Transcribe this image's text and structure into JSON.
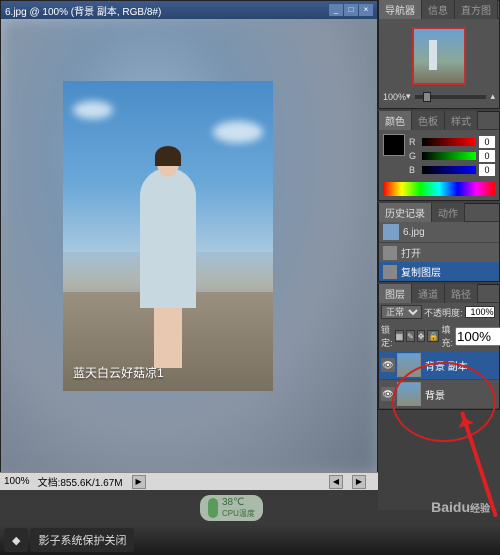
{
  "document": {
    "title": "6.jpg @ 100% (背景 副本, RGB/8#)",
    "caption": "蓝天白云好菇凉1"
  },
  "status": {
    "zoom": "100%",
    "docinfo": "文档:855.6K/1.67M"
  },
  "panels": {
    "navigator": {
      "tabs": [
        "导航器",
        "信息",
        "直方图"
      ],
      "zoom": "100%"
    },
    "color": {
      "tabs": [
        "颜色",
        "色板",
        "样式"
      ],
      "r": "0",
      "g": "0",
      "b": "0"
    },
    "history": {
      "tabs": [
        "历史记录",
        "动作"
      ],
      "file": "6.jpg",
      "items": [
        "打开",
        "复制图层"
      ]
    },
    "layers": {
      "tabs": [
        "图层",
        "通道",
        "路径"
      ],
      "blend": "正常",
      "opacity_label": "不透明度:",
      "opacity_val": "100%",
      "lock_label": "锁定:",
      "fill_label": "填充:",
      "fill_val": "100%",
      "rows": [
        {
          "name": "背景 副本",
          "active": true
        },
        {
          "name": "背景",
          "active": false
        }
      ]
    }
  },
  "taskbar": {
    "item": "影子系统保护关闭",
    "temp": "38℃",
    "temp_label": "CPU温度"
  },
  "watermark": {
    "brand": "Baidu",
    "sub": "经验"
  }
}
